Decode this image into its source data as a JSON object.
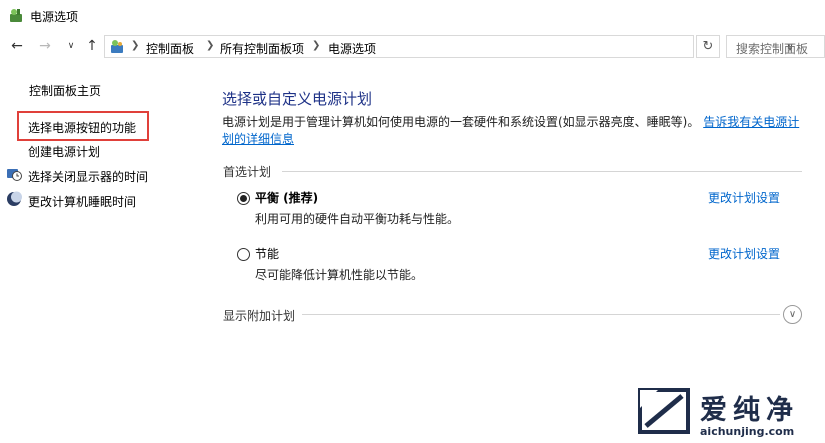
{
  "window": {
    "title": "电源选项"
  },
  "navbar": {
    "breadcrumbs": [
      "控制面板",
      "所有控制面板项",
      "电源选项"
    ],
    "search_placeholder": "搜索控制面板",
    "back_icon": "arrow-left-icon",
    "forward_icon": "arrow-right-icon",
    "recent_icon": "chevron-down-icon",
    "up_icon": "arrow-up-icon",
    "refresh_icon": "refresh-icon"
  },
  "sidebar": {
    "home": "控制面板主页",
    "items": [
      {
        "label": "选择电源按钮的功能",
        "icon": null,
        "highlighted": true
      },
      {
        "label": "创建电源计划",
        "icon": null
      },
      {
        "label": "选择关闭显示器的时间",
        "icon": "monitor-clock-icon"
      },
      {
        "label": "更改计算机睡眠时间",
        "icon": "moon-icon"
      }
    ]
  },
  "main": {
    "heading": "选择或自定义电源计划",
    "description": "电源计划是用于管理计算机如何使用电源的一套硬件和系统设置(如显示器亮度、睡眠等)。",
    "description_link": "告诉我有关电源计划的详细信息",
    "preferred_label": "首选计划",
    "plans": [
      {
        "name": "平衡 (推荐)",
        "desc": "利用可用的硬件自动平衡功耗与性能。",
        "link": "更改计划设置",
        "selected": true
      },
      {
        "name": "节能",
        "desc": "尽可能降低计算机性能以节能。",
        "link": "更改计划设置",
        "selected": false
      }
    ],
    "additional_label": "显示附加计划"
  },
  "watermark": {
    "text": "爱纯净",
    "url": "aichunjing.com"
  },
  "colors": {
    "accent": "#0066cc",
    "heading": "#1e3287",
    "highlight": "#e0403a"
  }
}
